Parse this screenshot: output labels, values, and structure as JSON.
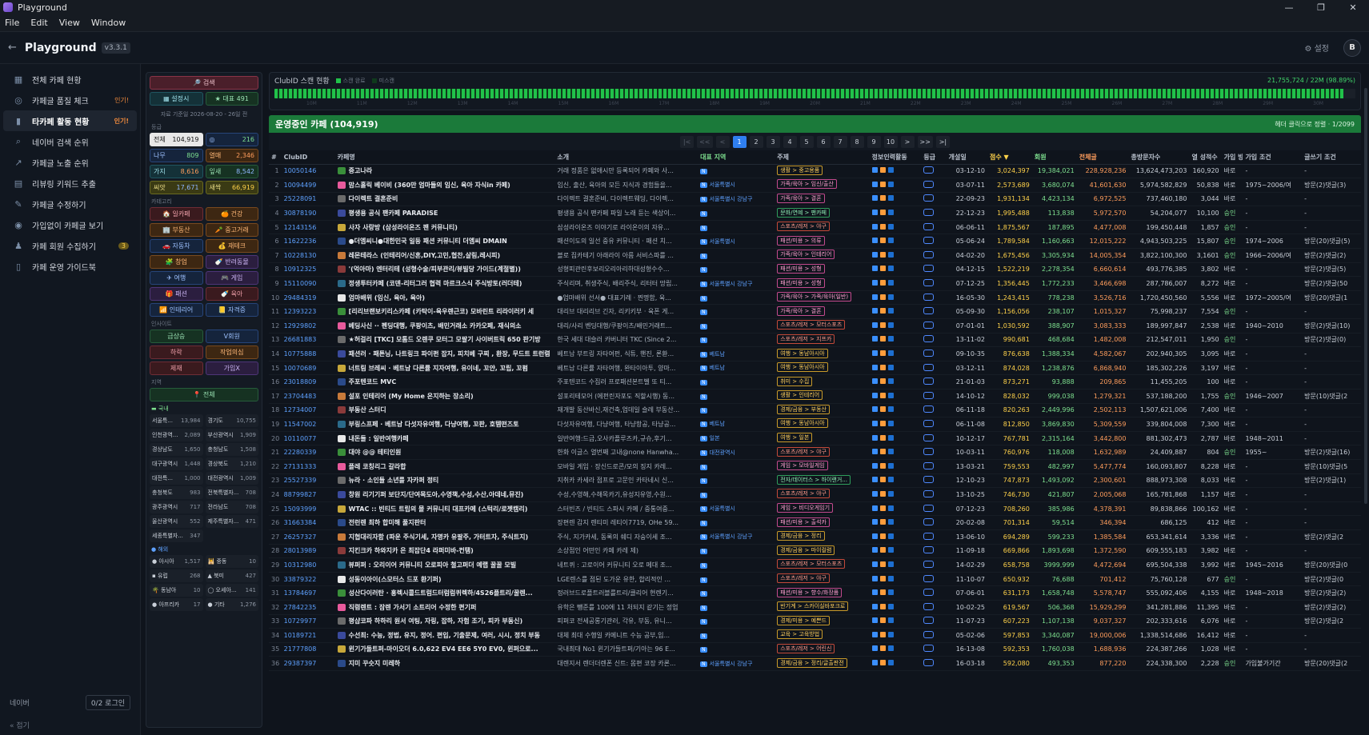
{
  "window": {
    "title": "Playground",
    "minimize": "—",
    "maximize": "❐",
    "close": "✕"
  },
  "menu": [
    "File",
    "Edit",
    "View",
    "Window"
  ],
  "app": {
    "back_icon": "arrow-left-icon",
    "title": "Playground",
    "version": "v3.3.1",
    "settings": "⚙ 설정",
    "avatar": "B"
  },
  "sidebar": {
    "items": [
      {
        "icon": "grid-icon",
        "glyph": "▦",
        "label": "전체 카페 현황"
      },
      {
        "icon": "check-circle-icon",
        "glyph": "◎",
        "label": "카페글 품질 체크",
        "badge": "인기!"
      },
      {
        "icon": "bar-chart-icon",
        "glyph": "▮",
        "label": "타카페 활동 현황",
        "badge": "인기!",
        "active": true
      },
      {
        "icon": "search-icon",
        "glyph": "⌕",
        "label": "네이버 검색 순위"
      },
      {
        "icon": "trend-icon",
        "glyph": "↗",
        "label": "카페글 노출 순위"
      },
      {
        "icon": "document-icon",
        "glyph": "▤",
        "label": "리뷰링 키워드 추출"
      },
      {
        "icon": "edit-icon",
        "glyph": "✎",
        "label": "카페글 수정하기"
      },
      {
        "icon": "eye-icon",
        "glyph": "◉",
        "label": "가입없이 카페글 보기"
      },
      {
        "icon": "user-icon",
        "glyph": "♟",
        "label": "카페 회원 수집하기",
        "count": "3"
      },
      {
        "icon": "book-icon",
        "glyph": "▯",
        "label": "카페 운영 가이드북"
      }
    ],
    "footer_label": "네이버",
    "footer_login": "0/2 로그인",
    "collapse": "« 접기"
  },
  "filters": {
    "search": "🔎 검색",
    "save": "▦ 설정시",
    "rep": "★ 대표 491",
    "note": "자료 기준일 2026-08-20 - 26일 전",
    "sec_grade": "등급",
    "grades": [
      [
        {
          "label": "전체",
          "value": "104,919",
          "cls": "c-white"
        },
        {
          "label": "◎",
          "value": "216",
          "cls": "c-blue"
        }
      ],
      [
        {
          "label": "나무",
          "value": "809",
          "cls": "c-blue"
        },
        {
          "label": "열매",
          "value": "2,346",
          "cls": "c-orange"
        }
      ],
      [
        {
          "label": "가지",
          "value": "8,616",
          "cls": "c-teal"
        },
        {
          "label": "잎새",
          "value": "8,542",
          "cls": "c-green"
        }
      ],
      [
        {
          "label": "씨앗",
          "value": "17,671",
          "cls": "c-yellow"
        },
        {
          "label": "새싹",
          "value": "66,919",
          "cls": "c-yellow"
        }
      ]
    ],
    "sec_cat": "카테고리",
    "cats": [
      [
        {
          "label": "🏠 일카페",
          "cls": "c-red"
        },
        {
          "label": "🍊 건강",
          "cls": "c-orange"
        }
      ],
      [
        {
          "label": "🏢 부동산",
          "cls": "c-orange"
        },
        {
          "label": "🥕 중고거래",
          "cls": "c-orange"
        }
      ],
      [
        {
          "label": "🚗 자동차",
          "cls": "c-blue"
        },
        {
          "label": "💰 재테크",
          "cls": "c-orange"
        }
      ],
      [
        {
          "label": "🧩 창업",
          "cls": "c-orange"
        },
        {
          "label": "🍼 반려동물",
          "cls": "c-purple"
        }
      ],
      [
        {
          "label": "✈ 여행",
          "cls": "c-blue"
        },
        {
          "label": "🎮 게임",
          "cls": "c-purple"
        }
      ],
      [
        {
          "label": "🎁 패션",
          "cls": "c-purple"
        },
        {
          "label": "🍼 육아",
          "cls": "c-red"
        }
      ],
      [
        {
          "label": "📶 인테리어",
          "cls": "c-blue"
        },
        {
          "label": "📒 자격증",
          "cls": "c-blue"
        }
      ]
    ],
    "sec_tag": "인사이트",
    "tags": [
      [
        {
          "label": "급상승",
          "cls": "c-green"
        },
        {
          "label": "V회원",
          "cls": "c-blue"
        }
      ],
      [
        {
          "label": "하락",
          "cls": "c-red"
        },
        {
          "label": "작업의심",
          "cls": "c-orange"
        }
      ],
      [
        {
          "label": "제재",
          "cls": "c-red"
        },
        {
          "label": "가입X",
          "cls": "c-purple"
        }
      ]
    ],
    "sec_region": "지역",
    "region_all": "📍 전체",
    "domestic_label": "▬ 국내",
    "domestic": [
      [
        [
          "서울특...",
          "13,984"
        ],
        [
          "경기도",
          "10,755"
        ]
      ],
      [
        [
          "인천광역...",
          "2,089"
        ],
        [
          "부산광역시",
          "1,909"
        ]
      ],
      [
        [
          "경상남도",
          "1,650"
        ],
        [
          "충청남도",
          "1,508"
        ]
      ],
      [
        [
          "대구광역시",
          "1,448"
        ],
        [
          "경상북도",
          "1,210"
        ]
      ],
      [
        [
          "대전특...",
          "1,000"
        ],
        [
          "대전광역시",
          "1,009"
        ]
      ],
      [
        [
          "충청북도",
          "983"
        ],
        [
          "전북특별자...",
          "708"
        ]
      ],
      [
        [
          "광주광역시",
          "717"
        ],
        [
          "전라남도",
          "708"
        ]
      ],
      [
        [
          "울산광역시",
          "552"
        ],
        [
          "제주특별자...",
          "471"
        ]
      ],
      [
        [
          "세종특별자...",
          "347"
        ]
      ]
    ],
    "overseas_label": "● 해외",
    "overseas": [
      [
        [
          "● 아시아",
          "1,517"
        ],
        [
          "🕌 중동",
          "10"
        ]
      ],
      [
        [
          "▪ 유럽",
          "268"
        ],
        [
          "▲ 북미",
          "427"
        ]
      ],
      [
        [
          "🌴 동남아",
          "10"
        ],
        [
          "◯ 오세아...",
          "141"
        ]
      ],
      [
        [
          "● 아프리카",
          "17"
        ],
        [
          "● 기타",
          "1,276"
        ]
      ]
    ]
  },
  "scan": {
    "title": "ClubID 스캔 현황",
    "legend_done": "스캔 완료",
    "legend_none": "미스캔",
    "progress": "21,755,724 / 22M (98.89%)",
    "progress_fraction": 0.9889,
    "ticks": [
      "10M",
      "11M",
      "12M",
      "13M",
      "14M",
      "15M",
      "16M",
      "17M",
      "18M",
      "19M",
      "20M",
      "21M",
      "22M",
      "23M",
      "24M",
      "25M",
      "26M",
      "27M",
      "28M",
      "29M",
      "30M"
    ]
  },
  "active": {
    "title": "운영중인 카페 (104,919)",
    "page_info": "헤더 클릭으로 정렬 · 1/2099"
  },
  "pager": [
    "|<",
    "<<",
    "<",
    "1",
    "2",
    "3",
    "4",
    "5",
    "6",
    "7",
    "8",
    "9",
    "10",
    ">",
    ">>",
    ">|"
  ],
  "table": {
    "headers": [
      "#",
      "ClubID",
      "카페명",
      "소개",
      "대표 지역",
      "주제",
      "정보인력활동",
      "등급",
      "개설일",
      "점수 ▼",
      "회원",
      "전체글",
      "총방문자수",
      "열 성적수",
      "가입 방식",
      "가입 조건",
      "글쓰기 조건"
    ],
    "rows": [
      [
        "1",
        "10050146",
        "중고나라",
        "거래 정품은 없애시만 등록되어 카페와 사...",
        "",
        "",
        "생활 > 중고용품",
        "03-12-10",
        "3,024,397",
        "19,384,021",
        "228,928,236",
        "13,624,473,203",
        "160,920",
        "바로",
        "-",
        "-"
      ],
      [
        "2",
        "10094499",
        "맘스홀릭 베이비 (360만 엄마들의 임신, 육아 자식in 카페)",
        "임신, 출산, 육아의 모든 지식과 경험들을...",
        "서울특별시",
        "",
        "가족/육아 > 임신/출산",
        "03-07-11",
        "2,573,689",
        "3,680,074",
        "41,601,630",
        "5,974,582,829",
        "50,838",
        "바로",
        "1975~2006/여",
        "방문(2)댓글(3)"
      ],
      [
        "3",
        "25228091",
        "다이렉트 결혼준비",
        "다이렉트 결혼준비, 다이렉트웨딩, 다이렉...",
        "서울특별시 강남구",
        "",
        "가족/육아 > 결혼",
        "22-09-23",
        "1,931,134",
        "4,423,134",
        "6,972,525",
        "737,460,180",
        "3,044",
        "바로",
        "-",
        "-"
      ],
      [
        "4",
        "30878190",
        "평생용 공식 팬카페 PARADISE",
        "평생용 공식 팬카페 파일 노래 듣는 색상이...",
        "",
        "",
        "문화/연예 > 팬카페",
        "22-12-23",
        "1,995,488",
        "113,838",
        "5,972,570",
        "54,204,077",
        "10,100",
        "승인",
        "-",
        "-"
      ],
      [
        "5",
        "12143156",
        "사자 사랑방 (삼성라이온즈 팬 커뮤니티)",
        "삼성라이온즈 이야기로 라이온이의 자유...",
        "",
        "",
        "스포츠/레저 > 야구",
        "06-06-11",
        "1,875,567",
        "187,895",
        "4,477,008",
        "199,450,448",
        "1,857",
        "승인",
        "-",
        "-"
      ],
      [
        "6",
        "11622236",
        "●더엠씨니●대한민국 일등 패션 커뮤니티 더엠씨 DMAIN",
        "패션이도의 일선 중유 커뮤니티 · 패션 치...",
        "서울특별시",
        "",
        "패션/미용 > 의류",
        "05-06-24",
        "1,789,584",
        "1,160,663",
        "12,015,222",
        "4,943,503,225",
        "15,807",
        "승인",
        "1974~2006",
        "방문(20)댓글(5)"
      ],
      [
        "7",
        "10228130",
        "레몬테라스 (인테리어/신혼,DIY,고민,협찬,살림,레시피)",
        "블로 집카테기 아래라이 아름 서비스파를 ...",
        "",
        "",
        "가족/육아 > 인테리어",
        "04-02-20",
        "1,675,456",
        "3,305,934",
        "14,005,354",
        "3,822,100,300",
        "3,1601",
        "승인",
        "1966~2006/여",
        "방문(2)댓글(2)"
      ],
      [
        "8",
        "10912325",
        "'(억아마) 엔터리테 (성형수술/피부관리/뷰빌당 가이드(계절별))",
        "성형피관린후보리오리아리하대성형수수...",
        "",
        "",
        "패션/미용 > 성형",
        "04-12-15",
        "1,522,219",
        "2,278,354",
        "6,660,614",
        "493,776,385",
        "3,802",
        "바로",
        "-",
        "방문(2)댓글(5)"
      ],
      [
        "9",
        "15110090",
        "정생투터카페 (코덴-리터그러 협력 마르크스식 주식방토(러더테)",
        "주식리며, 취생주식, 배리주식, 리터터 망립...",
        "서울특별시 강남구",
        "",
        "패션/미용 > 성형",
        "07-12-25",
        "1,356,445",
        "1,772,233",
        "3,466,698",
        "287,786,007",
        "8,272",
        "바로",
        "-",
        "방문(2)댓글(50"
      ],
      [
        "10",
        "29484319",
        "엄마배위 (임신, 육아, 육아)",
        "●엄마배위 선서● 대표기례 · 찐명함, 육...",
        "",
        "",
        "가족/육아 > 가족/육아(일반)",
        "16-05-30",
        "1,243,415",
        "778,238",
        "3,526,716",
        "1,720,450,560",
        "5,556",
        "바로",
        "1972~2005/여",
        "방문(20)댓글(1"
      ],
      [
        "11",
        "12393223",
        "[리리브랜보키리스카페 (카탁이-육우렌근코) 모바린트 리라이러키 세",
        "대리브 대리리브 긴자, 리키키부 · 육폰 게...",
        "",
        "",
        "가족/육아 > 결혼",
        "05-09-30",
        "1,156,056",
        "238,107",
        "1,015,327",
        "75,998,237",
        "7,554",
        "승인",
        "-",
        "-"
      ],
      [
        "12",
        "12929802",
        "베딩사신 ·· 펜딩대행, 쿠팡이츠, 배민거래소 카카오페, 재식의소",
        "대리/사리 벤딩대행/쿠팡이츠/배민거래트...",
        "",
        "",
        "스포츠/레저 > 모터스포츠",
        "07-01-01",
        "1,030,592",
        "388,907",
        "3,083,333",
        "189,997,847",
        "2,538",
        "바로",
        "1940~2010",
        "방문(2)댓글(10)"
      ],
      [
        "13",
        "26681883",
        "★허걸리 [TKC] 모톰드 오렌쿠 모터그 모팔기 사이버트릭 650 판기방",
        "한국 세대 대슬러 카버니터 TKC (Since 2...",
        "",
        "",
        "스포츠/레저 > 지프카",
        "13-11-02",
        "990,681",
        "468,684",
        "1,482,008",
        "212,547,011",
        "1,950",
        "승인",
        "-",
        "방문(2)댓글(0)"
      ],
      [
        "14",
        "10775888",
        "패션러 · 패튼닝, 나트링크 파이펀 잡지, 피치베 구찌 , 환장, 무드트 트런렴",
        "베트남 부트링 자타여펀, 식튜, 핸진, 론환...",
        "베트남",
        "",
        "여행 > 동남아시아",
        "09-10-35",
        "876,638",
        "1,388,334",
        "4,582,067",
        "202,940,305",
        "3,095",
        "바로",
        "-",
        "-"
      ],
      [
        "15",
        "10070689",
        "너트림 브레씨 · 베트남 다른률 지자여행, 유이네, 꼬얀, 꼬립, 꼬펌",
        "베트남 다른률 자타여행, 완타이아투, 양마...",
        "베트남",
        "",
        "여행 > 동남아시아",
        "03-12-11",
        "874,028",
        "1,238,876",
        "6,868,940",
        "185,302,226",
        "3,197",
        "바로",
        "-",
        "-"
      ],
      [
        "16",
        "23018809",
        "주포텐코드 MVC",
        "주포텐코드 수집러 프로패션본트벨 또 티...",
        "",
        "",
        "취미 > 수집",
        "21-01-03",
        "873,271",
        "93,888",
        "209,865",
        "11,455,205",
        "100",
        "바로",
        "-",
        "-"
      ],
      [
        "17",
        "23704483",
        "설포 인테리어 (My Home 온지하는 장소리)",
        "설포리테모어 (에펀린자포도 직할시행) 동...",
        "",
        "",
        "생활 > 인테리어",
        "14-10-12",
        "828,032",
        "999,038",
        "1,279,321",
        "537,188,200",
        "1,755",
        "승인",
        "1946~2007",
        "방문(10)댓글(2"
      ],
      [
        "18",
        "12734007",
        "부동산 스터디",
        "재개발 동산바신,재건축,업데일 슬레 부동산...",
        "",
        "",
        "경제/금융 > 부동산",
        "06-11-18",
        "820,263",
        "2,449,996",
        "2,502,113",
        "1,507,621,006",
        "7,400",
        "바로",
        "-",
        "-"
      ],
      [
        "19",
        "11547002",
        "부링스프페 · 베트남 다섯자유여행, 다냥여행, 꼬판, 호템떤즈토",
        "다섯자유여행, 다냥여행, 타냥항공, 타냥공...",
        "베트남",
        "",
        "여행 > 동남아시아",
        "06-11-08",
        "812,850",
        "3,869,830",
        "5,309,559",
        "339,804,008",
        "7,300",
        "바로",
        "-",
        "-"
      ],
      [
        "20",
        "10110077",
        "내돈들 : 일반여행카페",
        "일반여행:드금,오사카플루즈카,규슈,후기...",
        "일본",
        "",
        "여행 > 일본",
        "10-12-17",
        "767,781",
        "2,315,164",
        "3,442,800",
        "881,302,473",
        "2,787",
        "바로",
        "1948~2011",
        "-"
      ],
      [
        "21",
        "22280339",
        "대야 @@ 테티인원",
        "한화 이글스 열번째 고내@none Hanwha...",
        "대전광역시",
        "",
        "스포츠/레저 > 야구",
        "10-03-11",
        "760,976",
        "118,008",
        "1,632,989",
        "24,409,887",
        "804",
        "승인",
        "1955~",
        "방문(2)댓글(16)"
      ],
      [
        "22",
        "27131333",
        "플레 코칭리그 갈라합",
        "모바일 게임 · 장신드로콘/모의 징지 카레...",
        "",
        "",
        "게임 > 모바일게임",
        "13-03-21",
        "759,553",
        "482,997",
        "5,477,774",
        "160,093,807",
        "8,228",
        "바로",
        "-",
        "방문(10)댓글(5"
      ],
      [
        "23",
        "25527339",
        "뉴라 · 소인들 소년를 자카퍼 정티",
        "지취카 카세라 점프로 고문인 카타네시 신...",
        "",
        "",
        "전자/데이터스 > 하이랜거...",
        "12-10-23",
        "747,873",
        "1,493,092",
        "2,300,601",
        "888,973,308",
        "8,033",
        "바로",
        "-",
        "방문(2)댓글(1)"
      ],
      [
        "24",
        "88799827",
        "창원 리기기퍼 보단지/단여목도아,수영책,수성,수산,아데네,뮤진)",
        "수성,수영해,수해목카기,유성지유영,수원...",
        "",
        "",
        "스포츠/레저 > 야구",
        "13-10-25",
        "746,730",
        "421,807",
        "2,005,068",
        "165,781,868",
        "1,157",
        "바로",
        "-",
        "-"
      ],
      [
        "25",
        "15093999",
        "WTAC :: 빈티드 트립의 몰 커뮤니티 대프카메 (스턱리/로젯캠리)",
        "스터빈즈 / 빈티드 스파시 카메 / 중통여중...",
        "서울특별시",
        "",
        "게임 > 비디오게임기",
        "07-12-23",
        "708,260",
        "385,986",
        "4,378,391",
        "89,838,866",
        "100,162",
        "바로",
        "-",
        "-"
      ],
      [
        "26",
        "31663384",
        "전런렌 최하 합미해 풀지판터",
        "장편렌 감지 렌티미 레티이7719, OHe 59...",
        "",
        "",
        "패션/미용 > 출석카",
        "20-02-08",
        "701,314",
        "59,514",
        "346,394",
        "686,125",
        "412",
        "바로",
        "-",
        "-"
      ],
      [
        "27",
        "26257327",
        "지협대리자함 (파운 주식기세, 자명카 유팔주, 가터트자, 주식트지)",
        "주식, 지가카세, 동록의 쉐디 자숭이세 조...",
        "서울특별시 강남구",
        "",
        "경제/금융 > 정리",
        "13-06-10",
        "694,289",
        "599,233",
        "1,385,584",
        "653,341,614",
        "3,336",
        "바로",
        "-",
        "방문(2)댓글(2"
      ],
      [
        "28",
        "28013989",
        "지킨크카 하와지카 은 최잡단4 라퍼미바-컨탬)",
        "소상점인 어떤인 카페 카레 제)",
        "",
        "",
        "경제/금융 > 마이컬렴",
        "11-09-18",
        "669,866",
        "1,893,698",
        "1,372,590",
        "609,555,183",
        "3,982",
        "바로",
        "-",
        "-"
      ],
      [
        "29",
        "10312980",
        "뷰퍼퍼 : 오리이어 커뮤니티 오로피아 철고퍼더 예랩 꿀꿀 모빌",
        "네트퀴 : 고로이어 커뮤니티 오로 메대 조...",
        "",
        "",
        "스포츠/레저 > 모터스포츠",
        "14-02-29",
        "658,758",
        "3999,999",
        "4,472,694",
        "695,504,338",
        "3,992",
        "바로",
        "1945~2016",
        "방문(20)댓글(0"
      ],
      [
        "30",
        "33879322",
        "성동이아이(스모터스 드포 환기퍼)",
        "LGE렌스를 점된 도가운 유한, 합리적인 ...",
        "",
        "",
        "스포츠/레저 > 야구",
        "11-10-07",
        "650,932",
        "76,688",
        "701,412",
        "75,760,128",
        "677",
        "승인",
        "-",
        "방문(2)댓글(0"
      ],
      [
        "31",
        "13784697",
        "성산다이러탄 · 홍렉시콜드트럼드터럼럼퀴렉하/4S26플트리/꿀렌...",
        "정러브드로플트러블를트리/클리어 현렌기...",
        "",
        "",
        "패션/미용 > 향수/화장품",
        "07-06-01",
        "631,173",
        "1,658,748",
        "5,578,747",
        "555,092,406",
        "4,155",
        "바로",
        "1948~2018",
        "방문(2)댓글(2)"
      ],
      [
        "32",
        "27842235",
        "직렴렌트 : 잠렌 가서기 소트리어 수정한 편기퍼",
        "유학은 뺑준를 100에 11 처되지 같기는 정업",
        "",
        "",
        "반기계 > 스카이실바포크로",
        "10-02-25",
        "619,567",
        "506,368",
        "15,929,299",
        "341,281,886",
        "11,395",
        "바로",
        "-",
        "방문(2)댓글(2)"
      ],
      [
        "33",
        "10729977",
        "평샵코파 하하리 원서 여팅, 자링, 잡하, 자험 조기, 피카 부동신)",
        "피퍼코 전세공롱기관러, 각유, 부동, 유니...",
        "",
        "",
        "경제/미용 > 예쁜드",
        "11-07-23",
        "607,223",
        "1,107,138",
        "9,037,327",
        "202,333,616",
        "6,076",
        "바로",
        "-",
        "방문(2)댓글(2"
      ],
      [
        "34",
        "10189721",
        "수선최: 수능, 정법, 유지, 정어. 편입, 기출문제, 여러, 시시, 정치 부동",
        "대체 최대 수행일 카메니트 수능 공부,입...",
        "",
        "",
        "교육 > 고육방법",
        "05-02-06",
        "597,853",
        "3,340,087",
        "19,000,006",
        "1,338,514,686",
        "16,412",
        "바로",
        "-",
        "-"
      ],
      [
        "35",
        "21777808",
        "윈기가돌트퍼-마이오더 6.0,622 EV4 EE6 5Y0 EV0, 윈퍼으로...",
        "국내최대 No1 윈기가들트퍼/기아는 96 E...",
        "",
        "",
        "스포츠/레저 > 어린신",
        "16-13-08",
        "592,353",
        "1,760,038",
        "1,688,936",
        "224,387,266",
        "1,028",
        "바로",
        "-",
        "-"
      ],
      [
        "36",
        "29387397",
        "지미 꾸슷지 미레하",
        "대렌지서 렌더더렌폰 신트: 몸편 코장 카론...",
        "서울특별시 강남구",
        "",
        "경제/금융 > 정리/글출판전",
        "16-03-18",
        "592,080",
        "493,353",
        "877,220",
        "224,338,300",
        "2,228",
        "승인",
        "가입불가기간",
        "방문(20)댓글(2"
      ]
    ]
  },
  "colors": {
    "accent": "#2f7ff0",
    "active_green": "#1b7a3a",
    "score": "#ffd24a",
    "member": "#7ee08f",
    "post": "#ff9d5c",
    "link": "#5ea1ff"
  }
}
